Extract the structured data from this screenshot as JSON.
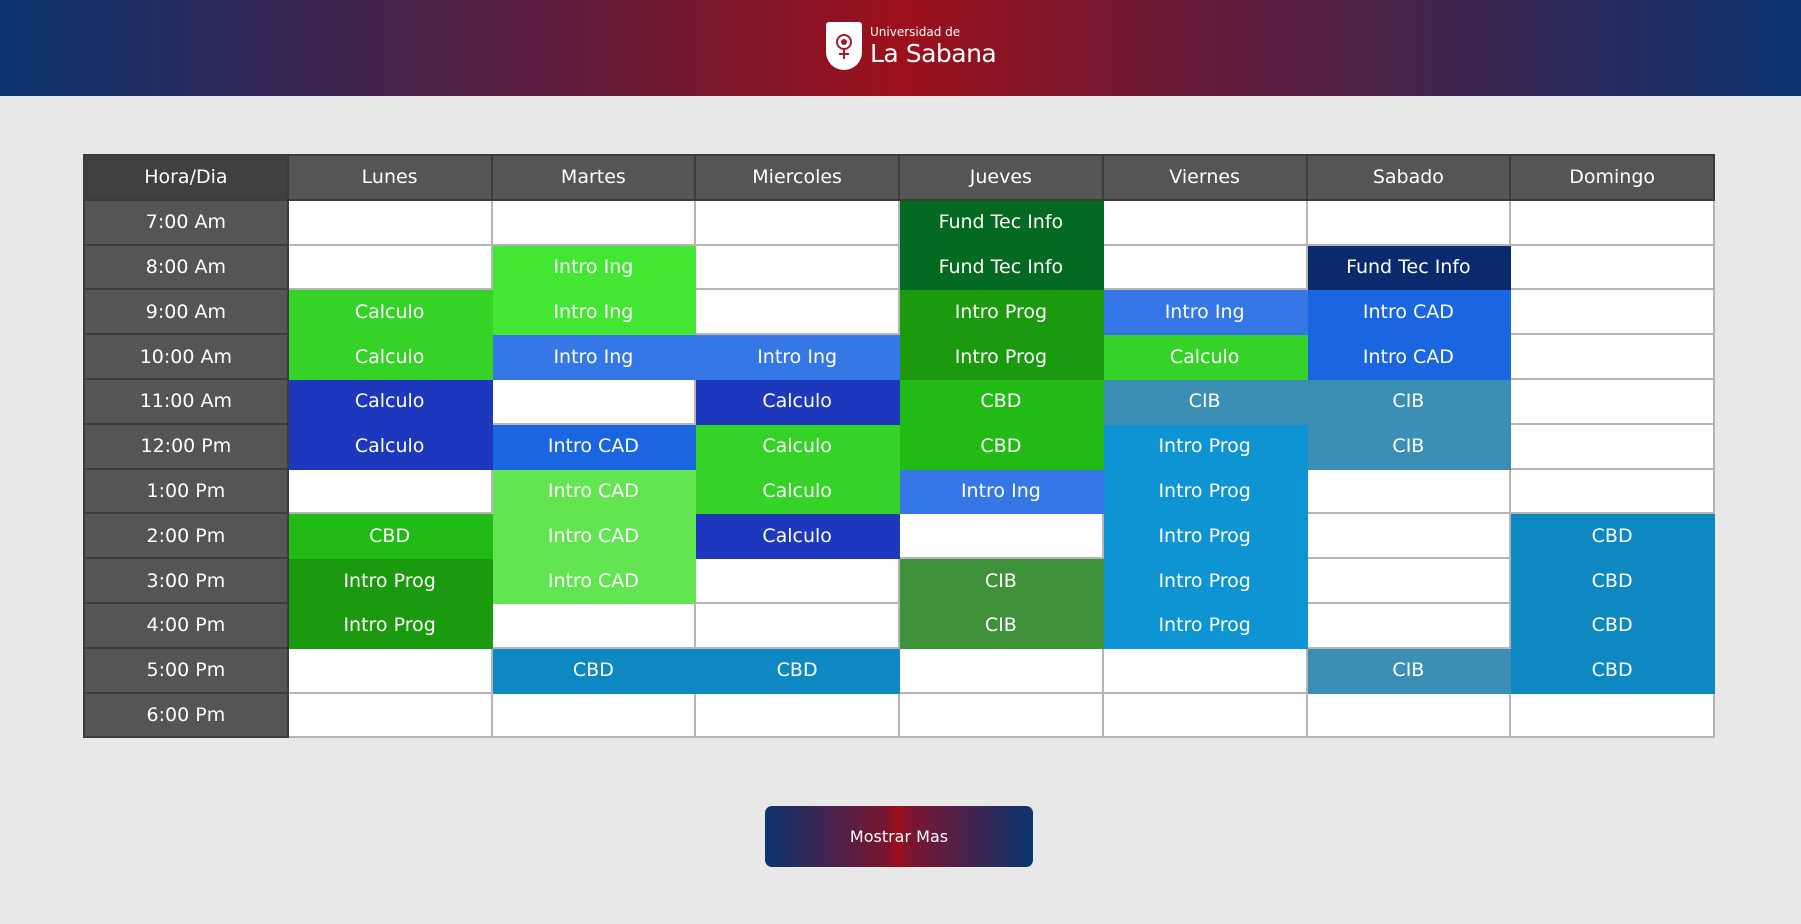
{
  "header": {
    "logo_small": "Universidad de",
    "logo_big": "La Sabana"
  },
  "schedule": {
    "corner_label": "Hora/Dia",
    "days": [
      "Lunes",
      "Martes",
      "Miercoles",
      "Jueves",
      "Viernes",
      "Sabado",
      "Domingo"
    ],
    "rows": [
      {
        "hour": "7:00 Am",
        "cells": [
          {
            "text": "",
            "color": ""
          },
          {
            "text": "",
            "color": ""
          },
          {
            "text": "",
            "color": ""
          },
          {
            "text": "Fund Tec Info",
            "color": "#056a21"
          },
          {
            "text": "",
            "color": ""
          },
          {
            "text": "",
            "color": ""
          },
          {
            "text": "",
            "color": ""
          }
        ]
      },
      {
        "hour": "8:00 Am",
        "cells": [
          {
            "text": "",
            "color": ""
          },
          {
            "text": "Intro Ing",
            "color": "#44e634"
          },
          {
            "text": "",
            "color": ""
          },
          {
            "text": "Fund Tec Info",
            "color": "#056a21"
          },
          {
            "text": "",
            "color": ""
          },
          {
            "text": "Fund Tec Info",
            "color": "#0a2a6d"
          },
          {
            "text": "",
            "color": ""
          }
        ]
      },
      {
        "hour": "9:00 Am",
        "cells": [
          {
            "text": "Calculo",
            "color": "#35d327"
          },
          {
            "text": "Intro Ing",
            "color": "#44e634"
          },
          {
            "text": "",
            "color": ""
          },
          {
            "text": "Intro Prog",
            "color": "#1b9a10"
          },
          {
            "text": "Intro Ing",
            "color": "#3577e6"
          },
          {
            "text": "Intro CAD",
            "color": "#1a65e0"
          },
          {
            "text": "",
            "color": ""
          }
        ]
      },
      {
        "hour": "10:00 Am",
        "cells": [
          {
            "text": "Calculo",
            "color": "#35d327"
          },
          {
            "text": "Intro Ing",
            "color": "#3577e6"
          },
          {
            "text": "Intro Ing",
            "color": "#3577e6"
          },
          {
            "text": "Intro Prog",
            "color": "#1b9a10"
          },
          {
            "text": "Calculo",
            "color": "#35d327"
          },
          {
            "text": "Intro CAD",
            "color": "#1a65e0"
          },
          {
            "text": "",
            "color": ""
          }
        ]
      },
      {
        "hour": "11:00 Am",
        "cells": [
          {
            "text": "Calculo",
            "color": "#1d38bd"
          },
          {
            "text": "",
            "color": ""
          },
          {
            "text": "Calculo",
            "color": "#1d38bd"
          },
          {
            "text": "CBD",
            "color": "#22bb16"
          },
          {
            "text": "CIB",
            "color": "#3b8fb5"
          },
          {
            "text": "CIB",
            "color": "#3b8fb5"
          },
          {
            "text": "",
            "color": ""
          }
        ]
      },
      {
        "hour": "12:00 Pm",
        "cells": [
          {
            "text": "Calculo",
            "color": "#1d38bd"
          },
          {
            "text": "Intro CAD",
            "color": "#1a65e0"
          },
          {
            "text": "Calculo",
            "color": "#35d327"
          },
          {
            "text": "CBD",
            "color": "#22bb16"
          },
          {
            "text": "Intro Prog",
            "color": "#0e94d3"
          },
          {
            "text": "CIB",
            "color": "#3b8fb5"
          },
          {
            "text": "",
            "color": ""
          }
        ]
      },
      {
        "hour": "1:00 Pm",
        "cells": [
          {
            "text": "",
            "color": ""
          },
          {
            "text": "Intro CAD",
            "color": "#62e550"
          },
          {
            "text": "Calculo",
            "color": "#35d327"
          },
          {
            "text": "Intro Ing",
            "color": "#3577e6"
          },
          {
            "text": "Intro Prog",
            "color": "#0e94d3"
          },
          {
            "text": "",
            "color": ""
          },
          {
            "text": "",
            "color": ""
          }
        ]
      },
      {
        "hour": "2:00 Pm",
        "cells": [
          {
            "text": "CBD",
            "color": "#22bb16"
          },
          {
            "text": "Intro CAD",
            "color": "#62e550"
          },
          {
            "text": "Calculo",
            "color": "#1d38bd"
          },
          {
            "text": "",
            "color": ""
          },
          {
            "text": "Intro Prog",
            "color": "#0e94d3"
          },
          {
            "text": "",
            "color": ""
          },
          {
            "text": "CBD",
            "color": "#0e88c0"
          }
        ]
      },
      {
        "hour": "3:00 Pm",
        "cells": [
          {
            "text": "Intro Prog",
            "color": "#1b9a10"
          },
          {
            "text": "Intro CAD",
            "color": "#62e550"
          },
          {
            "text": "",
            "color": ""
          },
          {
            "text": "CIB",
            "color": "#3f913a"
          },
          {
            "text": "Intro Prog",
            "color": "#0e94d3"
          },
          {
            "text": "",
            "color": ""
          },
          {
            "text": "CBD",
            "color": "#0e88c0"
          }
        ]
      },
      {
        "hour": "4:00 Pm",
        "cells": [
          {
            "text": "Intro Prog",
            "color": "#1b9a10"
          },
          {
            "text": "",
            "color": ""
          },
          {
            "text": "",
            "color": ""
          },
          {
            "text": "CIB",
            "color": "#3f913a"
          },
          {
            "text": "Intro Prog",
            "color": "#0e94d3"
          },
          {
            "text": "",
            "color": ""
          },
          {
            "text": "CBD",
            "color": "#0e88c0"
          }
        ]
      },
      {
        "hour": "5:00 Pm",
        "cells": [
          {
            "text": "",
            "color": ""
          },
          {
            "text": "CBD",
            "color": "#0e88c0"
          },
          {
            "text": "CBD",
            "color": "#0e88c0"
          },
          {
            "text": "",
            "color": ""
          },
          {
            "text": "",
            "color": ""
          },
          {
            "text": "CIB",
            "color": "#3b8fb5"
          },
          {
            "text": "CBD",
            "color": "#0e88c0"
          }
        ]
      },
      {
        "hour": "6:00 Pm",
        "cells": [
          {
            "text": "",
            "color": ""
          },
          {
            "text": "",
            "color": ""
          },
          {
            "text": "",
            "color": ""
          },
          {
            "text": "",
            "color": ""
          },
          {
            "text": "",
            "color": ""
          },
          {
            "text": "",
            "color": ""
          },
          {
            "text": "",
            "color": ""
          }
        ]
      }
    ]
  },
  "footer": {
    "button_label": "Mostrar Mas"
  },
  "icons": {
    "logo": "university-crest-icon"
  }
}
